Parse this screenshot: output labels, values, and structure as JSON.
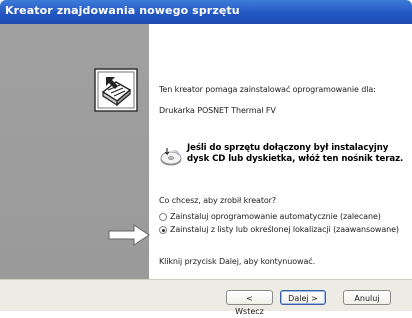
{
  "window": {
    "title": "Kreator znajdowania nowego sprzętu"
  },
  "content": {
    "intro": "Ten kreator pomaga zainstalować oprogramowanie dla:",
    "device_name": "Drukarka POSNET Thermal FV",
    "cd_notice_line1": "Jeśli do sprzętu dołączony był instalacyjny",
    "cd_notice_line2": "dysk CD lub dyskietka, włóż ten nośnik teraz.",
    "question": "Co chcesz, aby zrobił kreator?",
    "options": [
      {
        "label": "Zainstaluj oprogramowanie automatycznie (zalecane)",
        "selected": false
      },
      {
        "label": "Zainstaluj z listy lub określonej lokalizacji (zaawansowane)",
        "selected": true
      }
    ],
    "continue_hint": "Kliknij przycisk Dalej, aby kontynuować."
  },
  "buttons": {
    "back": "< Wstecz",
    "next": "Dalej >",
    "cancel": "Anuluj"
  },
  "icons": {
    "hardware": "hardware-wizard-icon",
    "cd": "cd-disc-icon",
    "arrow": "pointer-arrow-icon"
  }
}
